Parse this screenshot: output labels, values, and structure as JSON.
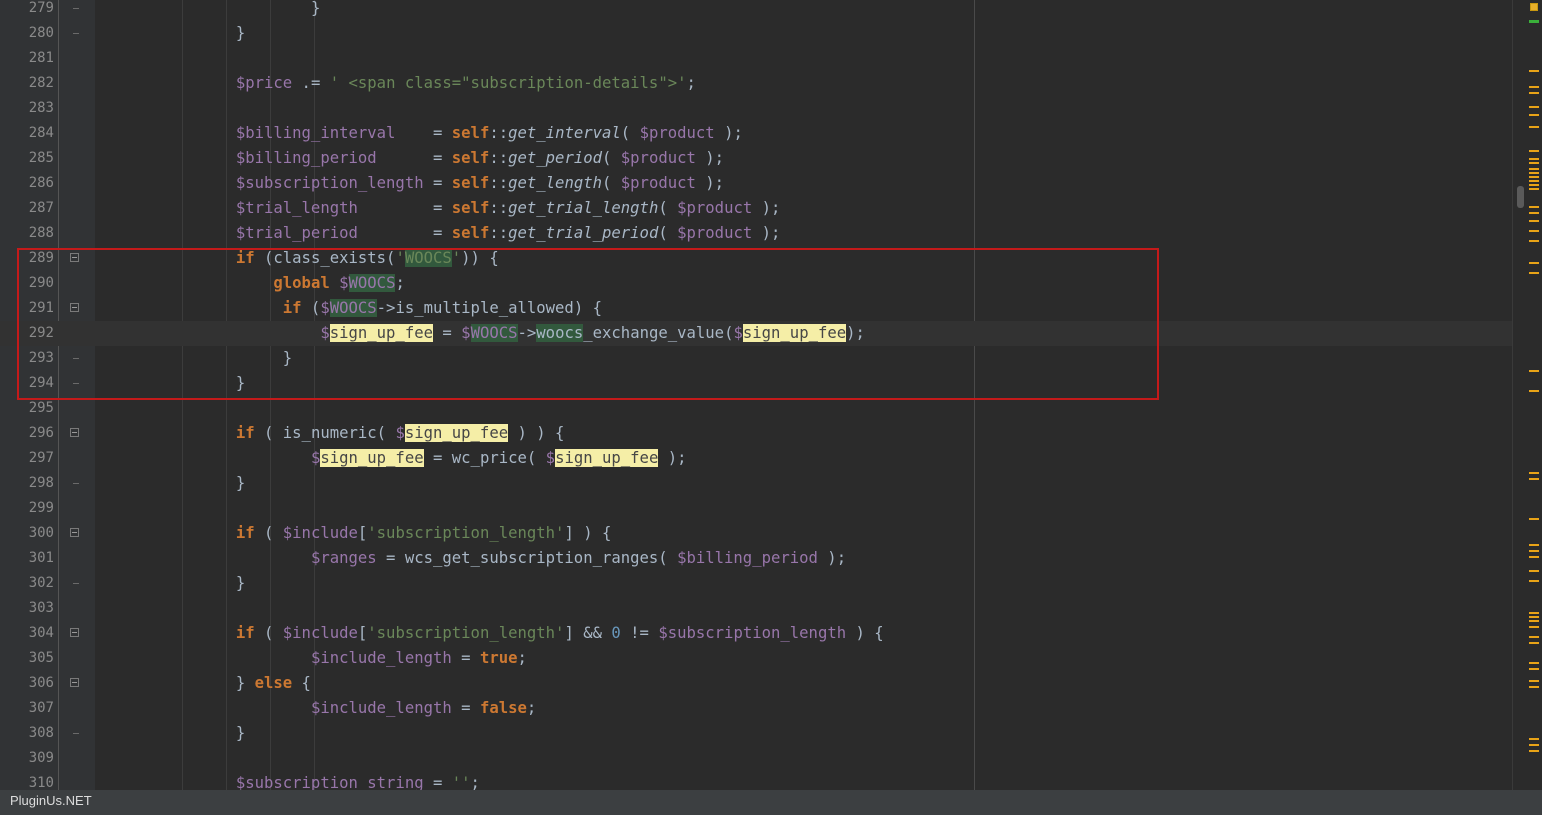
{
  "status_bar": {
    "watermark": "PluginUs.NET"
  },
  "lines": [
    {
      "n": "279",
      "fold": "end",
      "current": false,
      "tokens": [
        {
          "t": "                       "
        },
        {
          "t": "}"
        }
      ]
    },
    {
      "n": "280",
      "fold": "end",
      "current": false,
      "tokens": [
        {
          "t": "               "
        },
        {
          "t": "}"
        }
      ]
    },
    {
      "n": "281",
      "fold": "",
      "current": false,
      "tokens": []
    },
    {
      "n": "282",
      "fold": "",
      "current": false,
      "tokens": [
        {
          "t": "               "
        },
        {
          "t": "$price",
          "c": "var"
        },
        {
          "t": " .= "
        },
        {
          "t": "' <span class=\"subscription-details\">'",
          "c": "str"
        },
        {
          "t": ";"
        }
      ]
    },
    {
      "n": "283",
      "fold": "",
      "current": false,
      "tokens": []
    },
    {
      "n": "284",
      "fold": "",
      "current": false,
      "tokens": [
        {
          "t": "               "
        },
        {
          "t": "$billing_interval",
          "c": "var"
        },
        {
          "t": "    = "
        },
        {
          "t": "self",
          "c": "kw"
        },
        {
          "t": "::"
        },
        {
          "t": "get_interval",
          "c": "fn"
        },
        {
          "t": "( "
        },
        {
          "t": "$product",
          "c": "var"
        },
        {
          "t": " );"
        }
      ]
    },
    {
      "n": "285",
      "fold": "",
      "current": false,
      "tokens": [
        {
          "t": "               "
        },
        {
          "t": "$billing_period",
          "c": "var"
        },
        {
          "t": "      = "
        },
        {
          "t": "self",
          "c": "kw"
        },
        {
          "t": "::"
        },
        {
          "t": "get_period",
          "c": "fn"
        },
        {
          "t": "( "
        },
        {
          "t": "$product",
          "c": "var"
        },
        {
          "t": " );"
        }
      ]
    },
    {
      "n": "286",
      "fold": "",
      "current": false,
      "tokens": [
        {
          "t": "               "
        },
        {
          "t": "$subscription_length",
          "c": "var"
        },
        {
          "t": " = "
        },
        {
          "t": "self",
          "c": "kw"
        },
        {
          "t": "::"
        },
        {
          "t": "get_length",
          "c": "fn"
        },
        {
          "t": "( "
        },
        {
          "t": "$product",
          "c": "var"
        },
        {
          "t": " );"
        }
      ]
    },
    {
      "n": "287",
      "fold": "",
      "current": false,
      "tokens": [
        {
          "t": "               "
        },
        {
          "t": "$trial_length",
          "c": "var"
        },
        {
          "t": "        = "
        },
        {
          "t": "self",
          "c": "kw"
        },
        {
          "t": "::"
        },
        {
          "t": "get_trial_length",
          "c": "fn"
        },
        {
          "t": "( "
        },
        {
          "t": "$product",
          "c": "var"
        },
        {
          "t": " );"
        }
      ]
    },
    {
      "n": "288",
      "fold": "",
      "current": false,
      "tokens": [
        {
          "t": "               "
        },
        {
          "t": "$trial_period",
          "c": "var"
        },
        {
          "t": "        = "
        },
        {
          "t": "self",
          "c": "kw"
        },
        {
          "t": "::"
        },
        {
          "t": "get_trial_period",
          "c": "fn"
        },
        {
          "t": "( "
        },
        {
          "t": "$product",
          "c": "var"
        },
        {
          "t": " );"
        }
      ]
    },
    {
      "n": "289",
      "fold": "start",
      "current": false,
      "tokens": [
        {
          "t": "               "
        },
        {
          "t": "if",
          "c": "kw"
        },
        {
          "t": " (class_exists("
        },
        {
          "t": "'",
          "c": "str"
        },
        {
          "t": "WOOCS",
          "c": "str hl-green"
        },
        {
          "t": "'",
          "c": "str"
        },
        {
          "t": ")) {"
        }
      ]
    },
    {
      "n": "290",
      "fold": "",
      "current": false,
      "tokens": [
        {
          "t": "                   "
        },
        {
          "t": "global",
          "c": "kw"
        },
        {
          "t": " "
        },
        {
          "t": "$",
          "c": "var"
        },
        {
          "t": "WOOCS",
          "c": "var hl-green"
        },
        {
          "t": ";"
        }
      ]
    },
    {
      "n": "291",
      "fold": "start",
      "current": false,
      "tokens": [
        {
          "t": "                    "
        },
        {
          "t": "if",
          "c": "kw"
        },
        {
          "t": " ("
        },
        {
          "t": "$",
          "c": "var"
        },
        {
          "t": "WOOCS",
          "c": "var hl-green"
        },
        {
          "t": "->is_multiple_allowed) {"
        }
      ]
    },
    {
      "n": "292",
      "fold": "",
      "current": true,
      "tokens": [
        {
          "t": "                        "
        },
        {
          "t": "$",
          "c": "var"
        },
        {
          "t": "sign_up_fee",
          "c": "var hl-yellow"
        },
        {
          "t": " = "
        },
        {
          "t": "$",
          "c": "var"
        },
        {
          "t": "WOOCS",
          "c": "var hl-green"
        },
        {
          "t": "->"
        },
        {
          "t": "woocs",
          "c": "hl-green"
        },
        {
          "t": "_exchange_value("
        },
        {
          "t": "$",
          "c": "var"
        },
        {
          "t": "sign_up_fee",
          "c": "var hl-yellow"
        },
        {
          "t": ");"
        }
      ]
    },
    {
      "n": "293",
      "fold": "end",
      "current": false,
      "tokens": [
        {
          "t": "                    "
        },
        {
          "t": "}"
        }
      ]
    },
    {
      "n": "294",
      "fold": "end",
      "current": false,
      "tokens": [
        {
          "t": "               "
        },
        {
          "t": "}"
        }
      ]
    },
    {
      "n": "295",
      "fold": "",
      "current": false,
      "tokens": []
    },
    {
      "n": "296",
      "fold": "start",
      "current": false,
      "tokens": [
        {
          "t": "               "
        },
        {
          "t": "if",
          "c": "kw"
        },
        {
          "t": " ( is_numeric( "
        },
        {
          "t": "$",
          "c": "var"
        },
        {
          "t": "sign_up_fee",
          "c": "var hl-yellow"
        },
        {
          "t": " ) ) {"
        }
      ]
    },
    {
      "n": "297",
      "fold": "",
      "current": false,
      "tokens": [
        {
          "t": "                       "
        },
        {
          "t": "$",
          "c": "var"
        },
        {
          "t": "sign_up_fee",
          "c": "var hl-yellow"
        },
        {
          "t": " = wc_price( "
        },
        {
          "t": "$",
          "c": "var"
        },
        {
          "t": "sign_up_fee",
          "c": "var hl-yellow"
        },
        {
          "t": " );"
        }
      ]
    },
    {
      "n": "298",
      "fold": "end",
      "current": false,
      "tokens": [
        {
          "t": "               "
        },
        {
          "t": "}"
        }
      ]
    },
    {
      "n": "299",
      "fold": "",
      "current": false,
      "tokens": []
    },
    {
      "n": "300",
      "fold": "start",
      "current": false,
      "tokens": [
        {
          "t": "               "
        },
        {
          "t": "if",
          "c": "kw"
        },
        {
          "t": " ( "
        },
        {
          "t": "$include",
          "c": "var"
        },
        {
          "t": "["
        },
        {
          "t": "'subscription_length'",
          "c": "str"
        },
        {
          "t": "] ) {"
        }
      ]
    },
    {
      "n": "301",
      "fold": "",
      "current": false,
      "tokens": [
        {
          "t": "                       "
        },
        {
          "t": "$ranges",
          "c": "var"
        },
        {
          "t": " = wcs_get_subscription_ranges( "
        },
        {
          "t": "$billing_period",
          "c": "var"
        },
        {
          "t": " );"
        }
      ]
    },
    {
      "n": "302",
      "fold": "end",
      "current": false,
      "tokens": [
        {
          "t": "               "
        },
        {
          "t": "}"
        }
      ]
    },
    {
      "n": "303",
      "fold": "",
      "current": false,
      "tokens": []
    },
    {
      "n": "304",
      "fold": "start",
      "current": false,
      "tokens": [
        {
          "t": "               "
        },
        {
          "t": "if",
          "c": "kw"
        },
        {
          "t": " ( "
        },
        {
          "t": "$include",
          "c": "var"
        },
        {
          "t": "["
        },
        {
          "t": "'subscription_length'",
          "c": "str"
        },
        {
          "t": "] && "
        },
        {
          "t": "0",
          "c": "num"
        },
        {
          "t": " != "
        },
        {
          "t": "$subscription_length",
          "c": "var"
        },
        {
          "t": " ) {"
        }
      ]
    },
    {
      "n": "305",
      "fold": "",
      "current": false,
      "tokens": [
        {
          "t": "                       "
        },
        {
          "t": "$include_length",
          "c": "var"
        },
        {
          "t": " = "
        },
        {
          "t": "true",
          "c": "kw"
        },
        {
          "t": ";"
        }
      ]
    },
    {
      "n": "306",
      "fold": "start",
      "current": false,
      "tokens": [
        {
          "t": "               "
        },
        {
          "t": "} "
        },
        {
          "t": "else",
          "c": "kw"
        },
        {
          "t": " {"
        }
      ]
    },
    {
      "n": "307",
      "fold": "",
      "current": false,
      "tokens": [
        {
          "t": "                       "
        },
        {
          "t": "$include_length",
          "c": "var"
        },
        {
          "t": " = "
        },
        {
          "t": "false",
          "c": "kw"
        },
        {
          "t": ";"
        }
      ]
    },
    {
      "n": "308",
      "fold": "end",
      "current": false,
      "tokens": [
        {
          "t": "               "
        },
        {
          "t": "}"
        }
      ]
    },
    {
      "n": "309",
      "fold": "",
      "current": false,
      "tokens": []
    },
    {
      "n": "310",
      "fold": "",
      "current": false,
      "tokens": [
        {
          "t": "               "
        },
        {
          "t": "$subscription_string",
          "c": "var"
        },
        {
          "t": " = "
        },
        {
          "t": "''",
          "c": "str"
        },
        {
          "t": ";"
        }
      ]
    }
  ]
}
